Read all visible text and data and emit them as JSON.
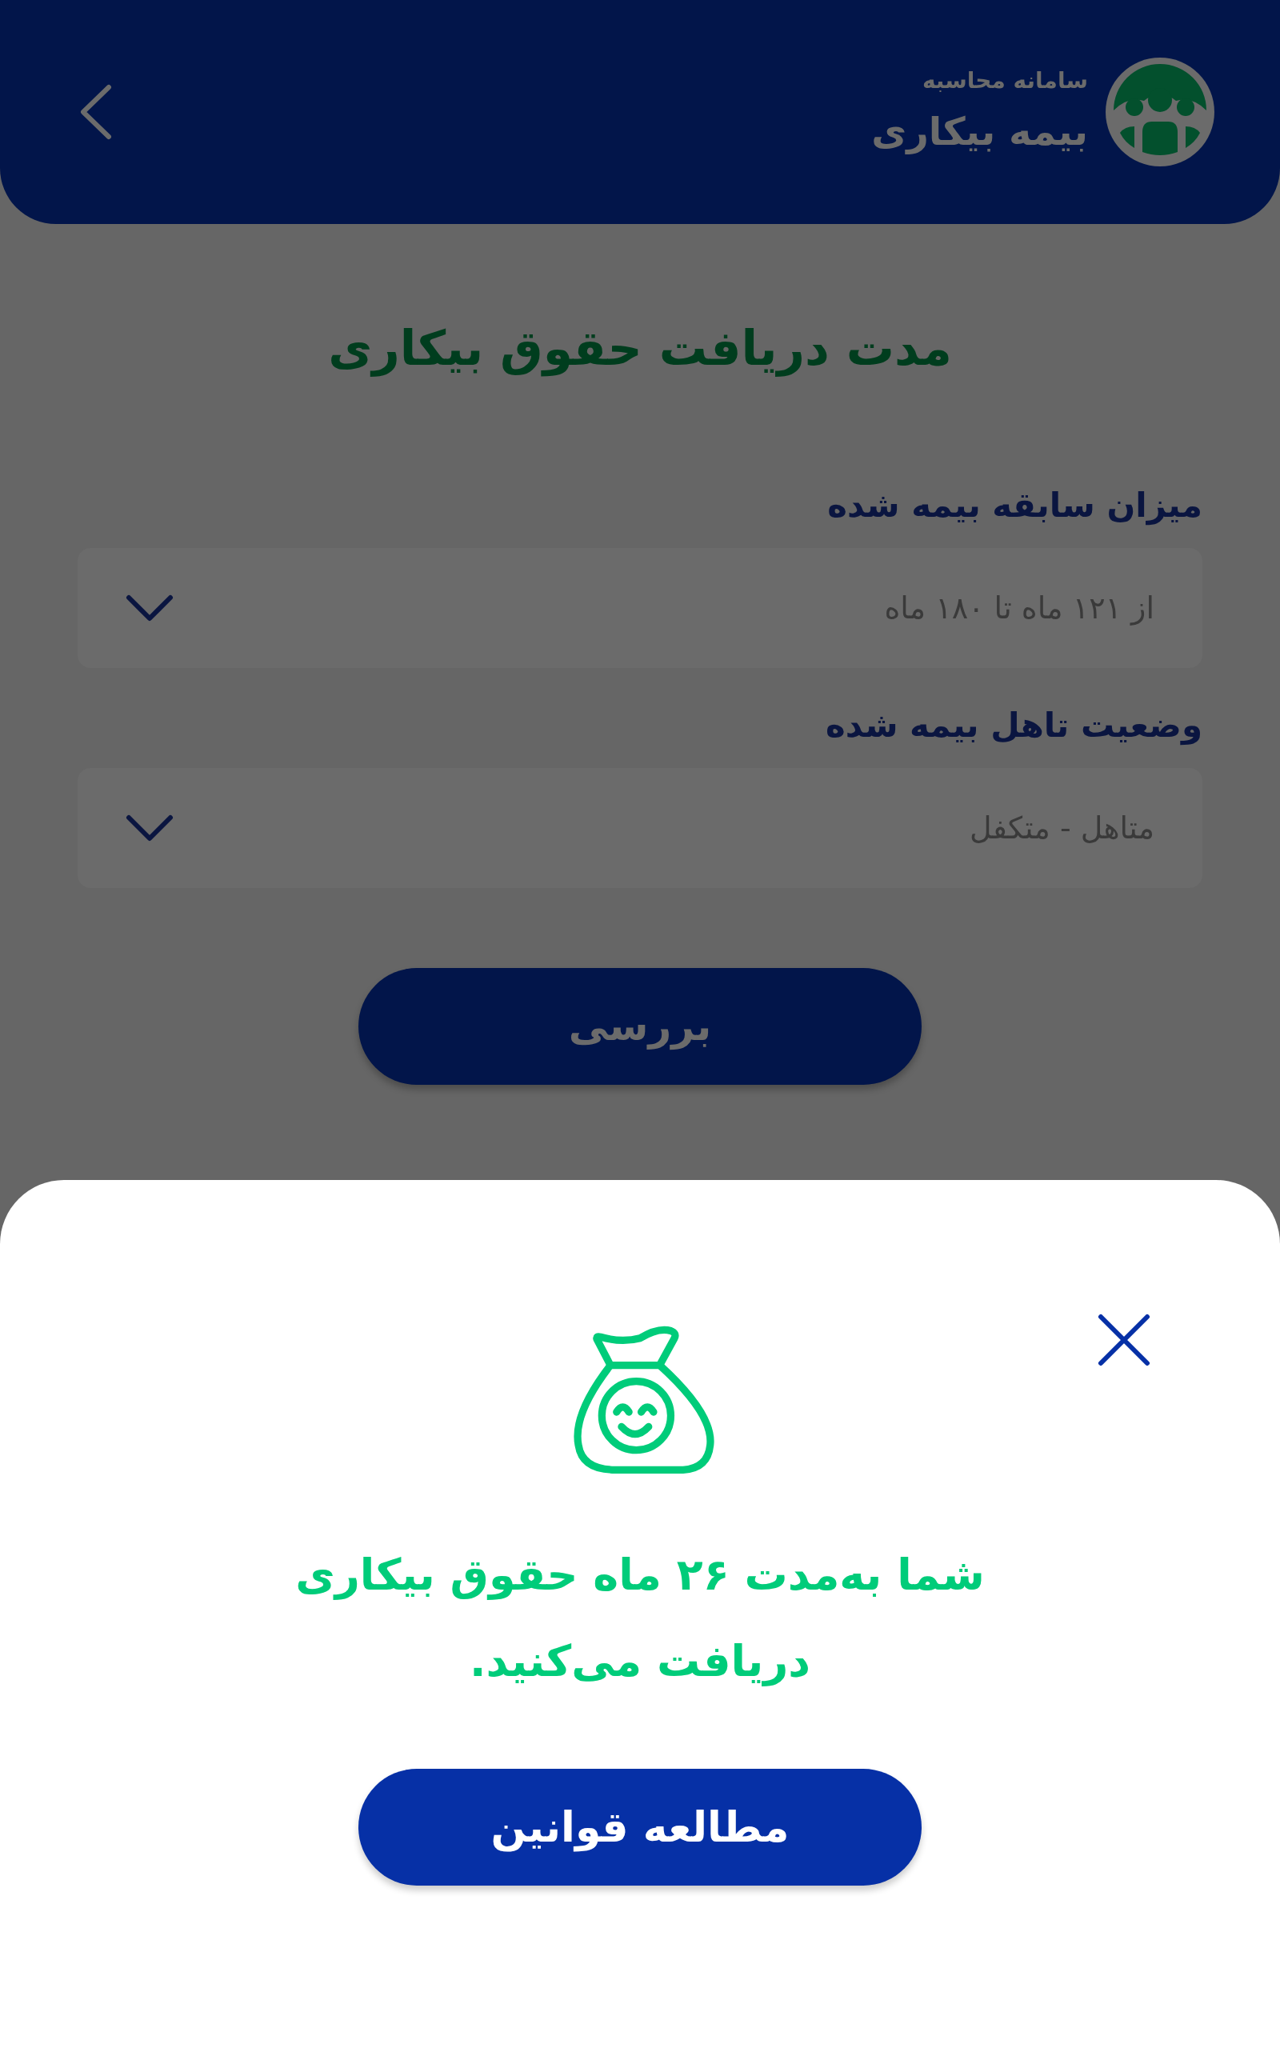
{
  "header": {
    "subtitle": "سامانه محاسبه",
    "title": "بیمه بیکاری"
  },
  "page_title": "مدت دریافت حقوق بیکاری",
  "fields": [
    {
      "label": "میزان سابقه بیمه شده",
      "value": "از ۱۲۱ ماه تا ۱۸۰ ماه"
    },
    {
      "label": "وضعیت تاهل بیمه شده",
      "value": "متاهل - متکفل"
    }
  ],
  "submit_button": "بررسی",
  "sheet": {
    "message": "شما به‌مدت ۲۶ ماه حقوق بیکاری دریافت می‌کنید.",
    "button": "مطالعه قوانین"
  }
}
